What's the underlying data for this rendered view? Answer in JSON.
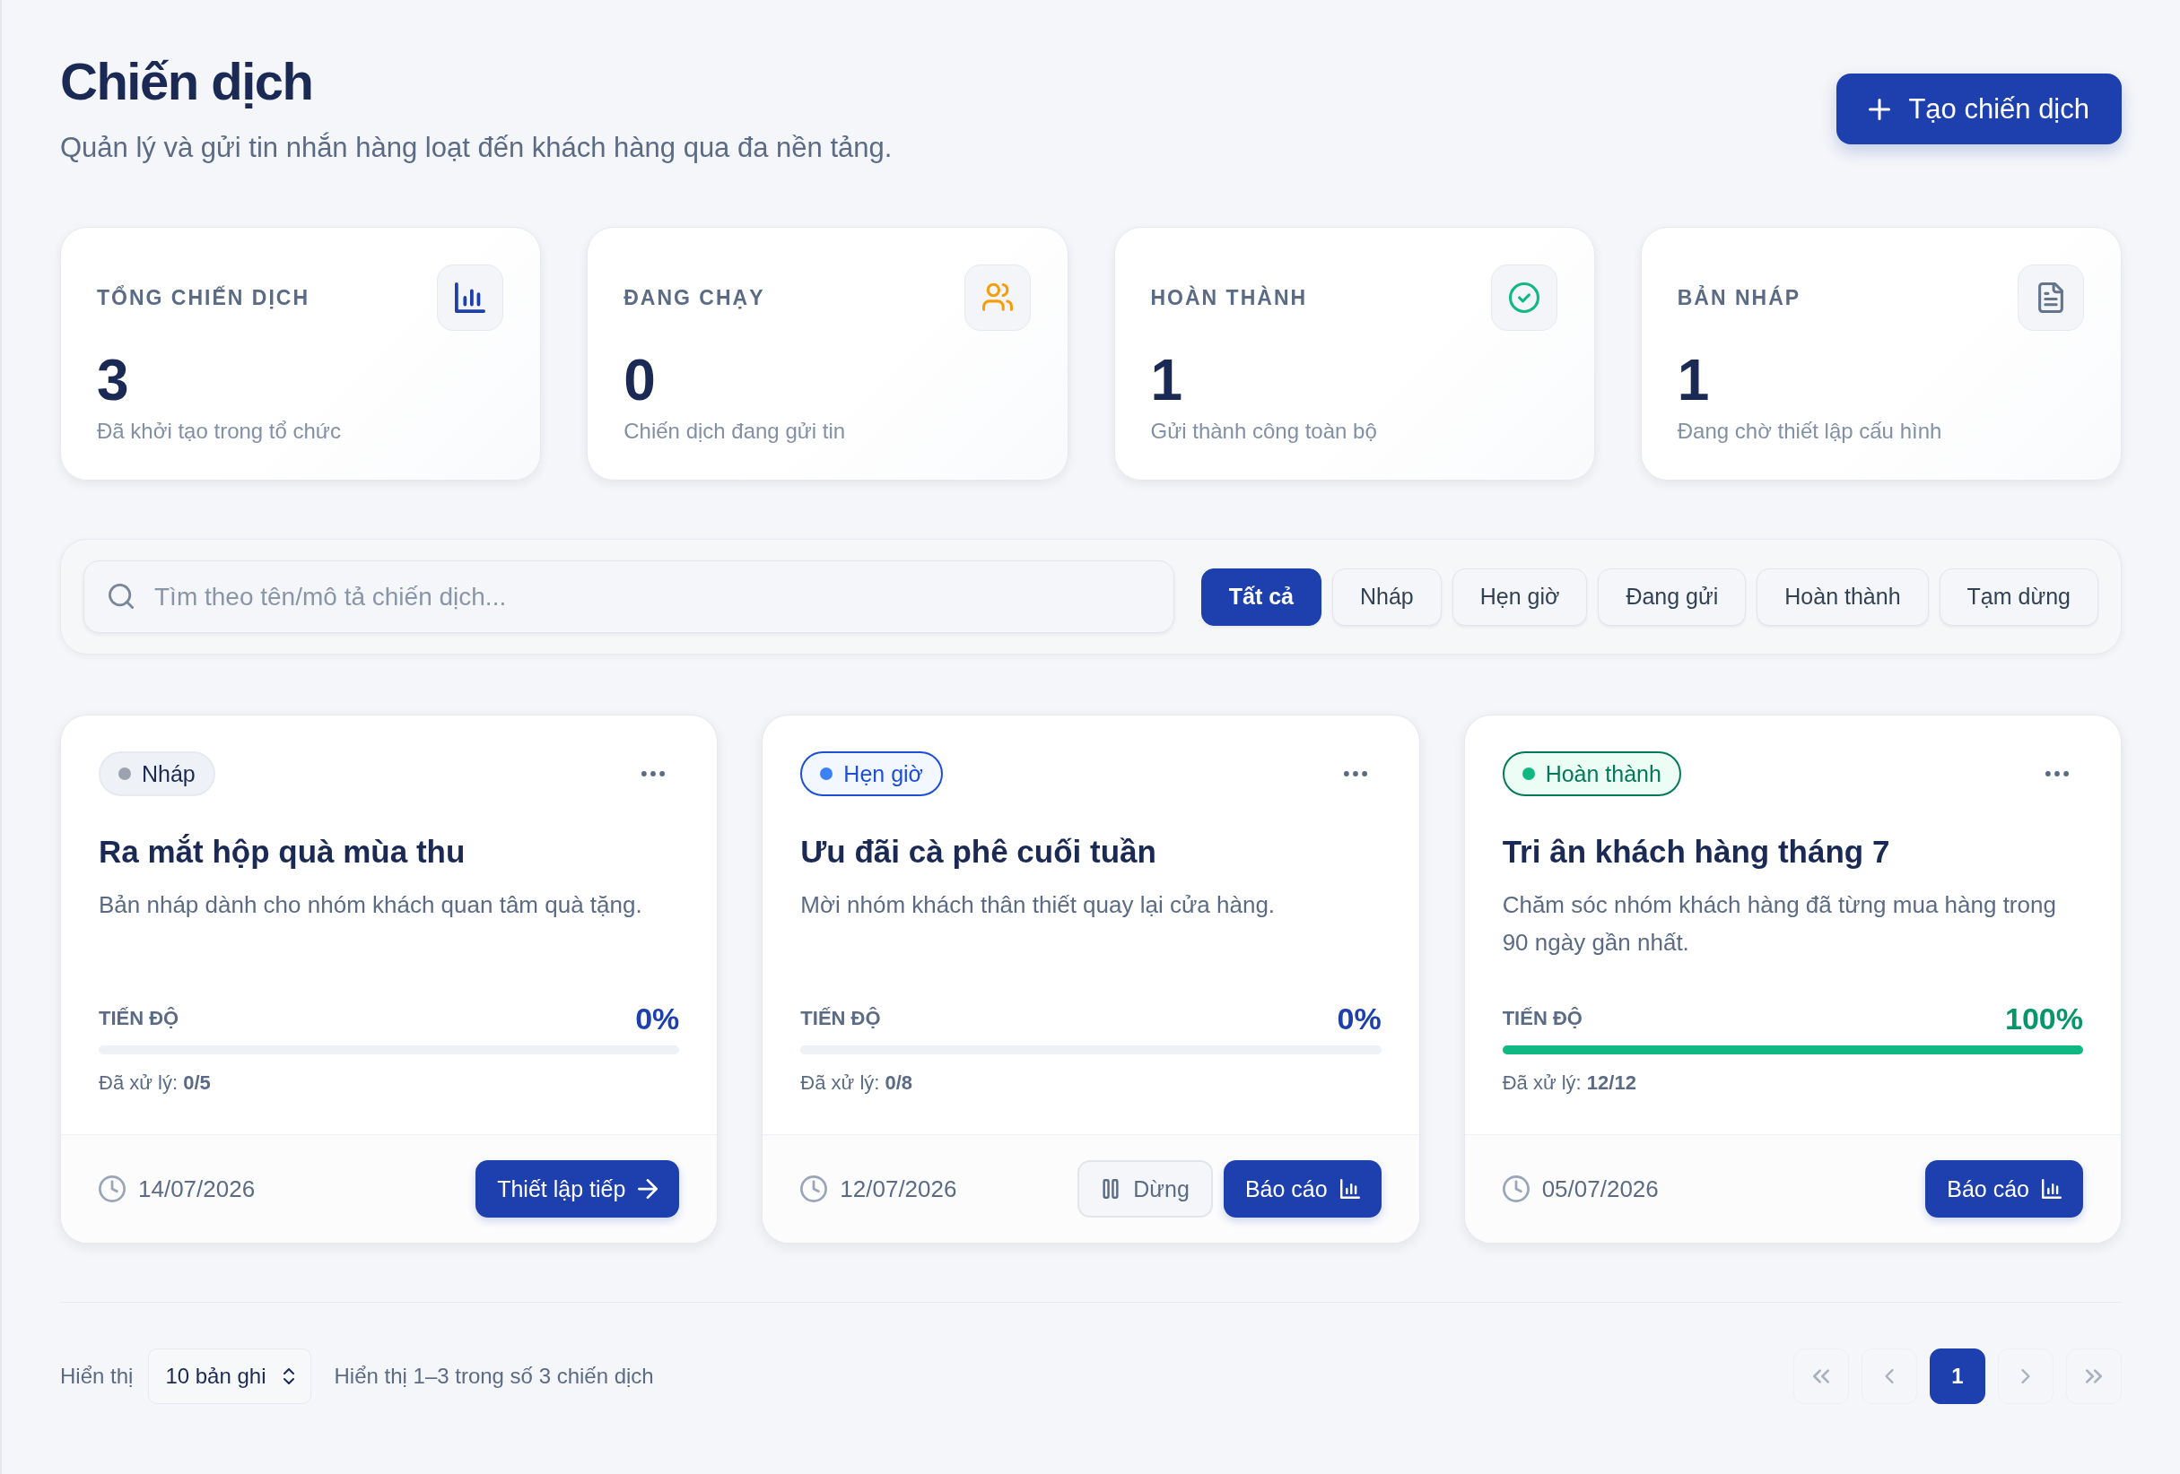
{
  "header": {
    "title": "Chiến dịch",
    "subtitle": "Quản lý và gửi tin nhắn hàng loạt đến khách hàng qua đa nền tảng.",
    "create_button": "Tạo chiến dịch"
  },
  "stats": [
    {
      "kind": "total",
      "label": "TỔNG CHIẾN DỊCH",
      "value": "3",
      "caption": "Đã khởi tạo trong tổ chức"
    },
    {
      "kind": "running",
      "label": "ĐANG CHẠY",
      "value": "0",
      "caption": "Chiến dịch đang gửi tin"
    },
    {
      "kind": "completed",
      "label": "HOÀN THÀNH",
      "value": "1",
      "caption": "Gửi thành công toàn bộ"
    },
    {
      "kind": "draft",
      "label": "BẢN NHÁP",
      "value": "1",
      "caption": "Đang chờ thiết lập cấu hình"
    }
  ],
  "filter_bar": {
    "search": {
      "placeholder": "Tìm theo tên/mô tả chiến dịch..."
    },
    "filters": [
      {
        "label": "Tất cả",
        "selected": true
      },
      {
        "label": "Nháp",
        "selected": false
      },
      {
        "label": "Hẹn giờ",
        "selected": false
      },
      {
        "label": "Đang gửi",
        "selected": false
      },
      {
        "label": "Hoàn thành",
        "selected": false
      },
      {
        "label": "Tạm dừng",
        "selected": false
      }
    ]
  },
  "campaigns": [
    {
      "status": {
        "kind": "draft",
        "label": "Nháp",
        "color": "#9ca3af"
      },
      "title": "Ra mắt hộp quà mùa thu",
      "description": "Bản nháp dành cho nhóm khách quan tâm quà tặng.",
      "progress_label": "TIẾN ĐỘ",
      "percent": "0%",
      "level": 0,
      "processed": "Đã xử lý: **0/5**",
      "date": "14/07/2026",
      "actions": [
        {
          "kind": "continue",
          "label": "Thiết lập tiếp"
        }
      ]
    },
    {
      "status": {
        "kind": "scheduled",
        "label": "Hẹn giờ",
        "color": "#3b82f6"
      },
      "title": "Ưu đãi cà phê cuối tuần",
      "description": "Mời nhóm khách thân thiết quay lại cửa hàng.",
      "progress_label": "TIẾN ĐỘ",
      "percent": "0%",
      "level": 0,
      "processed": "Đã xử lý: **0/8**",
      "date": "12/07/2026",
      "actions": [
        {
          "kind": "pause",
          "label": "Dừng"
        },
        {
          "kind": "report",
          "label": "Báo cáo"
        }
      ]
    },
    {
      "status": {
        "kind": "completed",
        "label": "Hoàn thành",
        "color": "#10b981"
      },
      "title": "Tri ân khách hàng tháng 7",
      "description": "Chăm sóc nhóm khách hàng đã từng mua hàng trong 90 ngày gần nhất.",
      "progress_label": "TIẾN ĐỘ",
      "percent": "100%",
      "level": 1,
      "processed": "Đã xử lý: **12/12**",
      "date": "05/07/2026",
      "actions": [
        {
          "kind": "report",
          "label": "Báo cáo"
        }
      ]
    }
  ],
  "footer": {
    "show_label": "Hiển thị",
    "page_size": "10 bản ghi",
    "summary": "Hiển thị 1–3 trong số 3 chiến dịch"
  },
  "pagination": {
    "buttons": [
      {
        "kind": "first",
        "disabled": true
      },
      {
        "kind": "previous",
        "disabled": true
      },
      {
        "kind": "page",
        "label": "1",
        "selected": true
      },
      {
        "kind": "next",
        "disabled": true
      },
      {
        "kind": "last",
        "disabled": true
      }
    ]
  }
}
